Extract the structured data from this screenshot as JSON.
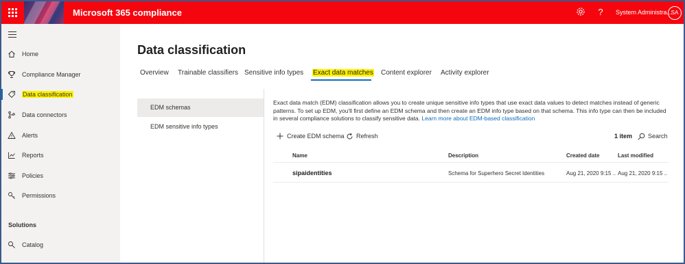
{
  "topbar": {
    "app_title": "Microsoft 365 compliance",
    "user_name": "System Administra...",
    "avatar_initials": "SA",
    "brand_color": "#f5060f",
    "icons": [
      "waffle-icon",
      "settings-icon",
      "help-icon"
    ]
  },
  "sidebar": {
    "items": [
      {
        "label": "Home",
        "icon": "home-icon"
      },
      {
        "label": "Compliance Manager",
        "icon": "trophy-icon"
      },
      {
        "label": "Data classification",
        "icon": "tag-icon"
      },
      {
        "label": "Data connectors",
        "icon": "connector-icon"
      },
      {
        "label": "Alerts",
        "icon": "alert-icon"
      },
      {
        "label": "Reports",
        "icon": "chart-icon"
      },
      {
        "label": "Policies",
        "icon": "sliders-icon"
      },
      {
        "label": "Permissions",
        "icon": "key-icon"
      },
      {
        "label": "Catalog",
        "icon": "catalog-icon"
      }
    ],
    "section_label": "Solutions",
    "active_item": "Data classification"
  },
  "main": {
    "title": "Data classification",
    "tabs": [
      {
        "label": "Overview"
      },
      {
        "label": "Trainable classifiers"
      },
      {
        "label": "Sensitive info types"
      },
      {
        "label": "Exact data matches"
      },
      {
        "label": "Content explorer"
      },
      {
        "label": "Activity explorer"
      }
    ],
    "active_tab": "Exact data matches",
    "subnav": [
      {
        "label": "EDM schemas"
      },
      {
        "label": "EDM sensitive info types"
      }
    ],
    "description": "Exact data match (EDM) classification allows you to create unique sensitive info types that use exact data values to detect matches instead of generic patterns. To set up EDM, you'll first define an EDM schema and then create an EDM info type based on that schema. This info type can then be included in several compliance solutions to classify sensitive data.",
    "learn_more": "Learn more about EDM-based classification",
    "commands": {
      "create": "Create EDM schema",
      "refresh": "Refresh",
      "count": "1 item",
      "search": "Search"
    },
    "table": {
      "columns": [
        "Name",
        "Description",
        "Created date",
        "Last modified"
      ],
      "rows": [
        {
          "name": "sipaidentities",
          "description": "Schema for Superhero Secret Identities",
          "created": "Aug 21, 2020 9:15 ...",
          "modified": "Aug 21, 2020 9:15 ..."
        }
      ]
    }
  }
}
